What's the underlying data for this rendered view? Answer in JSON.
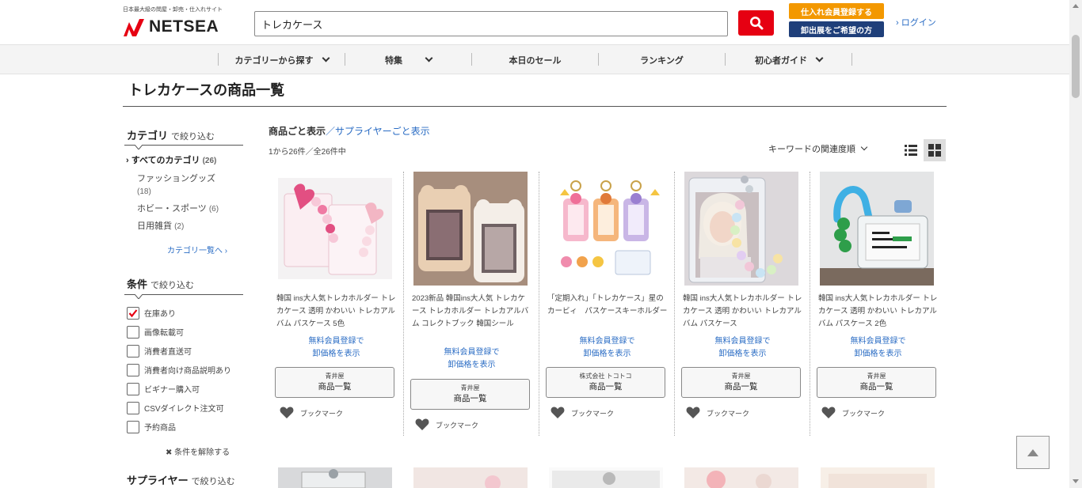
{
  "header": {
    "tagline": "日本最大級の問屋・卸売・仕入れサイト",
    "logo_text": "NETSEA",
    "search_value": "トレカケース",
    "register_button": "仕入れ会員登録する",
    "exhibit_button": "卸出展をご希望の方",
    "login_link": "ログイン",
    "brand_color": "#e60012"
  },
  "nav": {
    "items": [
      {
        "label": "カテゴリーから探す",
        "has_dropdown": true
      },
      {
        "label": "特集",
        "has_dropdown": true
      },
      {
        "label": "本日のセール",
        "has_dropdown": false
      },
      {
        "label": "ランキング",
        "has_dropdown": false
      },
      {
        "label": "初心者ガイド",
        "has_dropdown": true
      }
    ]
  },
  "page_title": "トレカケースの商品一覧",
  "sidebar": {
    "category_heading": "カテゴリ",
    "category_suffix": "で絞り込む",
    "all_categories": "すべてのカテゴリ",
    "all_count": "(26)",
    "categories": [
      {
        "name": "ファッショングッズ",
        "count": "(18)"
      },
      {
        "name": "ホビー・スポーツ",
        "count": "(6)"
      },
      {
        "name": "日用雑貨",
        "count": "(2)"
      }
    ],
    "category_list_link": "カテゴリ一覧へ ›",
    "condition_heading": "条件",
    "condition_suffix": "で絞り込む",
    "conditions": [
      {
        "label": "在庫あり",
        "checked": true
      },
      {
        "label": "画像転載可",
        "checked": false
      },
      {
        "label": "消費者直送可",
        "checked": false
      },
      {
        "label": "消費者向け商品説明あり",
        "checked": false
      },
      {
        "label": "ビギナー購入可",
        "checked": false
      },
      {
        "label": "CSVダイレクト注文可",
        "checked": false
      },
      {
        "label": "予約商品",
        "checked": false
      }
    ],
    "clear_conditions": "条件を解除する",
    "supplier_heading": "サプライヤー",
    "supplier_suffix": "で絞り込む"
  },
  "results": {
    "view_by_product": "商品ごと表示",
    "view_separator": "／",
    "view_by_supplier": "サプライヤーごと表示",
    "count_text": "1から26件／全26件中",
    "sort_label": "キーワードの関連度順",
    "member_line1": "無料会員登録で",
    "member_line2": "卸価格を表示",
    "supplier_button_label": "商品一覧",
    "bookmark_label": "ブックマーク",
    "products": [
      {
        "name": "韓国 ins大人気トレカホルダー トレカケース 透明 かわいい トレカアルバム パスケース 5色",
        "supplier": "青井屋",
        "image": "pink-heart-holders"
      },
      {
        "name": "2023新品 韓国ins大人気 トレカケース トレカホルダー トレカアルバム コレクトブック 韓国シール",
        "supplier": "青井屋",
        "image": "plush-bear-holders"
      },
      {
        "name": "「定期入れ」「トレカケース」星のカービィ　パスケースキーホルダー",
        "supplier": "株式会社 トコトコ",
        "image": "kirby-pass-cases"
      },
      {
        "name": "韓国 ins大人気トレカホルダー トレカケース 透明 かわいい トレカアルバム パスケース",
        "supplier": "青井屋",
        "image": "bead-strap-holder"
      },
      {
        "name": "韓国 ins大人気トレカホルダー トレカケース 透明 かわいい トレカアルバム パスケース 2色",
        "supplier": "青井屋",
        "image": "green-strap-holder"
      }
    ]
  }
}
